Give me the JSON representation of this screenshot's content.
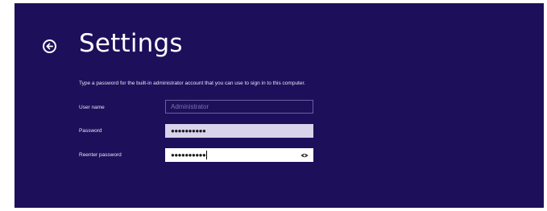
{
  "header": {
    "title": "Settings"
  },
  "instruction": "Type a password for the built-in administrator account that you can use to sign in to this computer.",
  "fields": {
    "user_name": {
      "label": "User name",
      "value": "Administrator"
    },
    "password": {
      "label": "Password",
      "value": "●●●●●●●●●●"
    },
    "reenter_password": {
      "label": "Reenter password",
      "value": "●●●●●●●●●●"
    }
  },
  "icons": {
    "back": "back-arrow-circle-icon",
    "reveal": "eye-icon"
  },
  "colors": {
    "background": "#1e0f5b",
    "text": "#ffffff"
  }
}
